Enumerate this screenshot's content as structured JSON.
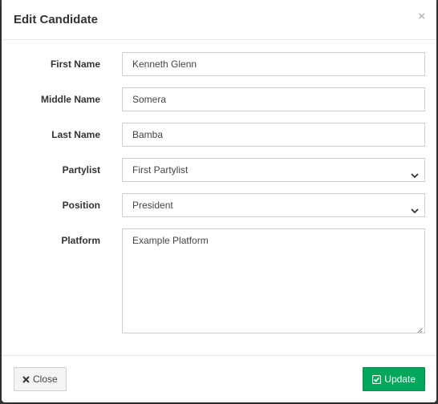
{
  "modal": {
    "title": "Edit Candidate",
    "close_glyph": "×"
  },
  "form": {
    "firstname": {
      "label": "First Name",
      "value": "Kenneth Glenn"
    },
    "middlename": {
      "label": "Middle Name",
      "value": "Somera"
    },
    "lastname": {
      "label": "Last Name",
      "value": "Bamba"
    },
    "partylist": {
      "label": "Partylist",
      "selected": "First Partylist"
    },
    "position": {
      "label": "Position",
      "selected": "President"
    },
    "platform": {
      "label": "Platform",
      "value": "Example Platform"
    }
  },
  "footer": {
    "close_label": "Close",
    "update_label": "Update",
    "close_icon": "times-icon",
    "update_icon": "check-square-icon"
  },
  "colors": {
    "update_button": "#00a65a",
    "backdrop": "#3a3a3a"
  }
}
